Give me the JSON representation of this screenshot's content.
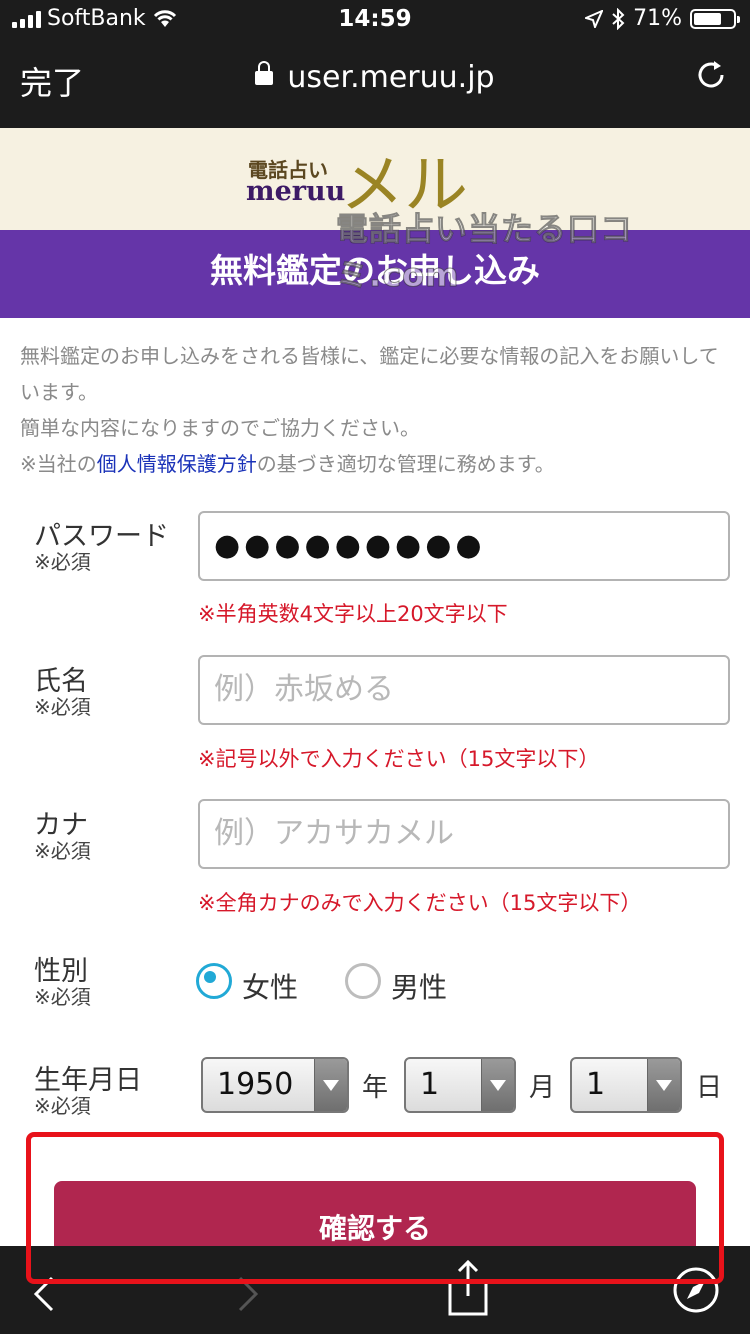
{
  "status_bar": {
    "carrier": "SoftBank",
    "time": "14:59",
    "battery": "71%",
    "battery_level": 0.71
  },
  "browser": {
    "done_label": "完了",
    "url": "user.meruu.jp"
  },
  "logo": {
    "small": "電話占い",
    "name": "meruu",
    "big": "メル"
  },
  "watermark": "電話占い当たる口コミ.com",
  "page": {
    "title": "無料鑑定のお申し込み",
    "intro_line1": "無料鑑定のお申し込みをされる皆様に、鑑定に必要な情報の記入をお願いしています。",
    "intro_line2": "簡単な内容になりますのでご協力ください。",
    "intro_prefix": "※当社の",
    "intro_link": "個人情報保護方針",
    "intro_suffix": "の基づき適切な管理に務めます。"
  },
  "form": {
    "required": "※必須",
    "password": {
      "label": "パスワード",
      "value": "●●●●●●●●●",
      "note": "※半角英数4文字以上20文字以下"
    },
    "name": {
      "label": "氏名",
      "placeholder": "例）赤坂める",
      "note": "※記号以外で入力ください（15文字以下）"
    },
    "kana": {
      "label": "カナ",
      "placeholder": "例）アカサカメル",
      "note": "※全角カナのみで入力ください（15文字以下）"
    },
    "gender": {
      "label": "性別",
      "female": "女性",
      "male": "男性",
      "selected": "女性"
    },
    "birthday": {
      "label": "生年月日",
      "year": "1950",
      "year_unit": "年",
      "month": "1",
      "month_unit": "月",
      "day": "1",
      "day_unit": "日"
    },
    "submit_label": "確認する"
  },
  "colors": {
    "header": "#6535a8",
    "button": "#b0264f",
    "highlight": "#e8121a",
    "note": "#d6182a",
    "radio": "#21a9d6"
  },
  "toolbar_icons": [
    "back-icon",
    "forward-icon",
    "share-icon",
    "safari-compass-icon"
  ]
}
